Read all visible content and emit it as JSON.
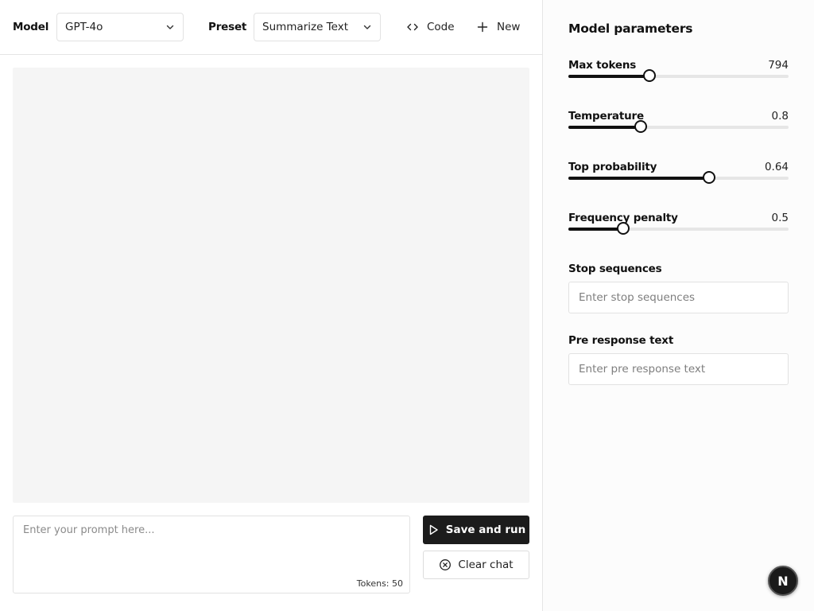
{
  "toolbar": {
    "model_label": "Model",
    "model_value": "GPT-4o",
    "preset_label": "Preset",
    "preset_value": "Summarize Text",
    "code_label": "Code",
    "new_label": "New"
  },
  "prompt": {
    "placeholder": "Enter your prompt here...",
    "tokens": "Tokens: 50"
  },
  "actions": {
    "run_label": "Save and run",
    "clear_label": "Clear chat"
  },
  "params": {
    "title": "Model parameters",
    "sliders": [
      {
        "label": "Max tokens",
        "value": "794",
        "fraction": 0.37
      },
      {
        "label": "Temperature",
        "value": "0.8",
        "fraction": 0.33
      },
      {
        "label": "Top probability",
        "value": "0.64",
        "fraction": 0.64
      },
      {
        "label": "Frequency penalty",
        "value": "0.5",
        "fraction": 0.25
      }
    ],
    "stop_label": "Stop sequences",
    "stop_placeholder": "Enter stop sequences",
    "pre_label": "Pre response text",
    "pre_placeholder": "Enter pre response text"
  },
  "avatar": {
    "letter": "N"
  },
  "colors": {
    "primary": "#1c1c1c",
    "canvas": "#f5f5f5",
    "border": "#e2e2e2"
  },
  "icons": [
    "chevron-down-icon",
    "code-icon",
    "plus-icon",
    "play-icon",
    "x-circle-icon"
  ]
}
